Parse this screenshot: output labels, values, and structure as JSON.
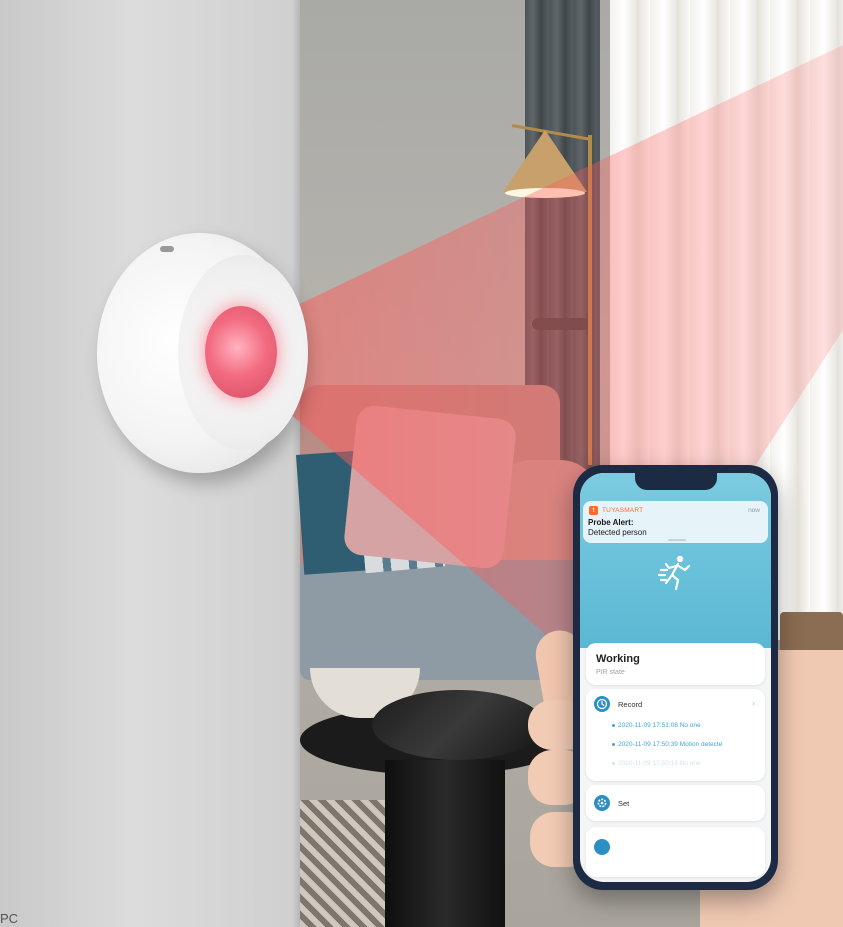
{
  "app": {
    "name": "TUYASMART",
    "notification": {
      "time": "now",
      "title": "Probe Alert:",
      "body": "Detected person"
    },
    "status": {
      "state": "Working",
      "label": "PIR state"
    },
    "record": {
      "label": "Record",
      "entries": [
        "2020-11-09 17:51:08 No one",
        "2020-11-09 17:50:39 Motion detecte",
        "2020-11-09 17:50:18 No one"
      ]
    },
    "settings": {
      "label": "Set"
    }
  },
  "corner_text": "PC",
  "colors": {
    "brand": "#ff6a2b",
    "accent": "#2b8fc4",
    "beam": "#ff5a5a"
  },
  "icons": {
    "app": "tuya-logo-icon",
    "runner": "running-person-icon",
    "record": "clock-icon",
    "settings": "gear-icon",
    "chevron": "chevron-right-icon"
  }
}
